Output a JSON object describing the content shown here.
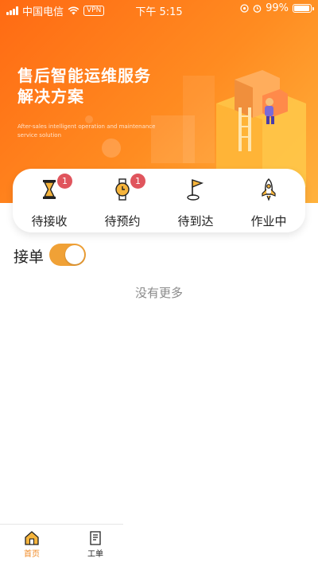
{
  "status_bar": {
    "carrier": "中国电信",
    "vpn": "VPN",
    "time": "下午 5:15",
    "battery": "99%",
    "icons": [
      "signal-icon",
      "wifi-icon",
      "location-icon",
      "alarm-icon",
      "battery-icon"
    ]
  },
  "hero": {
    "title_line1": "售后智能运维服务",
    "title_line2": "解决方案",
    "subtitle": "After-sales intelligent operation and maintenance service solution"
  },
  "categories": [
    {
      "label": "待接收",
      "badge": "1",
      "icon": "hourglass-icon"
    },
    {
      "label": "待预约",
      "badge": "1",
      "icon": "watch-icon"
    },
    {
      "label": "待到达",
      "badge": "",
      "icon": "flag-icon"
    },
    {
      "label": "作业中",
      "badge": "",
      "icon": "rocket-icon"
    }
  ],
  "accept_orders": {
    "label": "接单",
    "enabled": true
  },
  "list": {
    "empty_text": "没有更多"
  },
  "tabbar": {
    "items": [
      {
        "label": "首页",
        "icon": "home-icon",
        "active": true
      },
      {
        "label": "工单",
        "icon": "document-icon",
        "active": false
      }
    ]
  },
  "colors": {
    "accent": "#ff7a1a",
    "active_tab": "#f08a24",
    "toggle_on": "#f0a136",
    "badge": "#e0555d"
  }
}
